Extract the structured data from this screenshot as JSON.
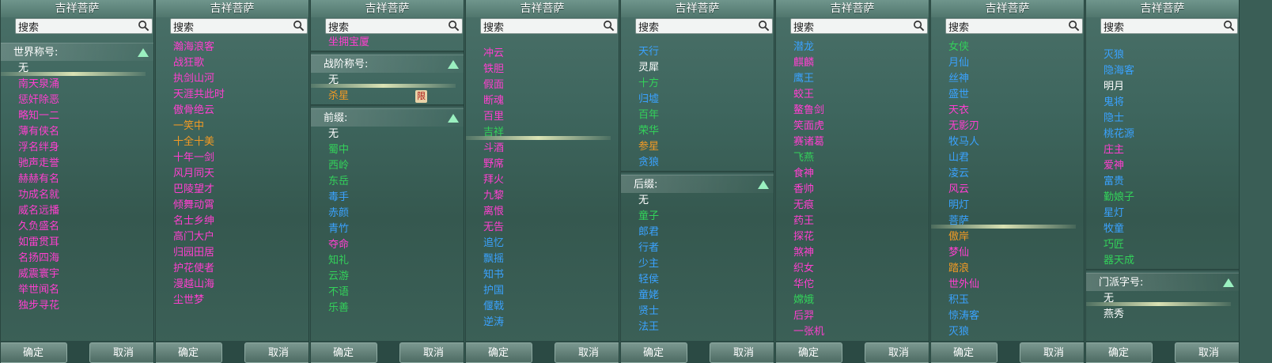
{
  "common": {
    "title": "吉祥菩萨",
    "search_placeholder": "搜索",
    "ok": "确定",
    "cancel": "取消"
  },
  "panels": [
    {
      "header1": "世界称号:",
      "items": [
        {
          "t": "无",
          "c": "white",
          "sel": true
        },
        {
          "t": "南天泉涌",
          "c": "mag"
        },
        {
          "t": "惩奸除恶",
          "c": "mag"
        },
        {
          "t": "略知一二",
          "c": "mag"
        },
        {
          "t": "薄有侠名",
          "c": "mag"
        },
        {
          "t": "浮名绊身",
          "c": "mag"
        },
        {
          "t": "驰声走誉",
          "c": "mag"
        },
        {
          "t": "赫赫有名",
          "c": "mag"
        },
        {
          "t": "功成名就",
          "c": "mag"
        },
        {
          "t": "威名远播",
          "c": "mag"
        },
        {
          "t": "久负盛名",
          "c": "mag"
        },
        {
          "t": "如雷贯耳",
          "c": "mag"
        },
        {
          "t": "名扬四海",
          "c": "mag"
        },
        {
          "t": "威震寰宇",
          "c": "mag"
        },
        {
          "t": "举世闻名",
          "c": "mag"
        },
        {
          "t": "独步寻花",
          "c": "mag"
        }
      ]
    },
    {
      "items": [
        {
          "t": "瀚海浪客",
          "c": "mag"
        },
        {
          "t": "战狂歌",
          "c": "mag"
        },
        {
          "t": "执剑山河",
          "c": "mag"
        },
        {
          "t": "天涯共此时",
          "c": "mag"
        },
        {
          "t": "傲骨绝云",
          "c": "mag"
        },
        {
          "t": "一笑中",
          "c": "orange"
        },
        {
          "t": "十全十美",
          "c": "orange"
        },
        {
          "t": "十年一剑",
          "c": "mag"
        },
        {
          "t": "风月同天",
          "c": "mag"
        },
        {
          "t": "巴陵望才",
          "c": "mag"
        },
        {
          "t": "倾舞动霄",
          "c": "mag"
        },
        {
          "t": "名士乡绅",
          "c": "mag"
        },
        {
          "t": "高门大户",
          "c": "mag"
        },
        {
          "t": "归园田居",
          "c": "mag"
        },
        {
          "t": "护花使者",
          "c": "mag"
        },
        {
          "t": "漫越山海",
          "c": "mag"
        },
        {
          "t": "尘世梦",
          "c": "mag"
        }
      ]
    },
    {
      "top_item": {
        "t": "坐拥宝厦",
        "c": "mag"
      },
      "header1": "战阶称号:",
      "mid_items": [
        {
          "t": "无",
          "c": "white",
          "sel": true
        },
        {
          "t": "杀星",
          "c": "orange",
          "badge": "限"
        }
      ],
      "header2": "前缀:",
      "items": [
        {
          "t": "无",
          "c": "white"
        },
        {
          "t": "蜀中",
          "c": "green"
        },
        {
          "t": "西岭",
          "c": "green"
        },
        {
          "t": "东岳",
          "c": "green"
        },
        {
          "t": "毒手",
          "c": "blue"
        },
        {
          "t": "赤颜",
          "c": "blue"
        },
        {
          "t": "青竹",
          "c": "blue"
        },
        {
          "t": "夺命",
          "c": "mag"
        },
        {
          "t": "知礼",
          "c": "green"
        },
        {
          "t": "云游",
          "c": "green"
        },
        {
          "t": "不语",
          "c": "green"
        },
        {
          "t": "乐善",
          "c": "green"
        }
      ]
    },
    {
      "items": [
        {
          "t": "冲云",
          "c": "mag"
        },
        {
          "t": "铁胆",
          "c": "mag"
        },
        {
          "t": "假面",
          "c": "mag"
        },
        {
          "t": "断魂",
          "c": "mag"
        },
        {
          "t": "百里",
          "c": "mag"
        },
        {
          "t": "吉祥",
          "c": "green",
          "sel": true
        },
        {
          "t": "斗酒",
          "c": "mag"
        },
        {
          "t": "野席",
          "c": "mag"
        },
        {
          "t": "拜火",
          "c": "mag"
        },
        {
          "t": "九黎",
          "c": "mag"
        },
        {
          "t": "离恨",
          "c": "mag"
        },
        {
          "t": "无告",
          "c": "mag"
        },
        {
          "t": "追忆",
          "c": "blue"
        },
        {
          "t": "飘摇",
          "c": "blue"
        },
        {
          "t": "知书",
          "c": "blue"
        },
        {
          "t": "护国",
          "c": "blue"
        },
        {
          "t": "偃戟",
          "c": "blue"
        },
        {
          "t": "逆涛",
          "c": "blue"
        }
      ]
    },
    {
      "items": [
        {
          "t": "天行",
          "c": "blue"
        },
        {
          "t": "灵犀",
          "c": "white"
        },
        {
          "t": "十方",
          "c": "green"
        },
        {
          "t": "归墟",
          "c": "blue"
        },
        {
          "t": "百年",
          "c": "green"
        },
        {
          "t": "荣华",
          "c": "green"
        },
        {
          "t": "参星",
          "c": "orange"
        },
        {
          "t": "贪狼",
          "c": "blue"
        }
      ],
      "header2": "后缀:",
      "items2": [
        {
          "t": "无",
          "c": "white"
        },
        {
          "t": "童子",
          "c": "green"
        },
        {
          "t": "郎君",
          "c": "blue"
        },
        {
          "t": "行者",
          "c": "blue"
        },
        {
          "t": "少主",
          "c": "blue"
        },
        {
          "t": "轻侯",
          "c": "blue"
        },
        {
          "t": "童姥",
          "c": "blue"
        },
        {
          "t": "贤士",
          "c": "blue"
        },
        {
          "t": "法王",
          "c": "blue"
        }
      ]
    },
    {
      "items": [
        {
          "t": "潜龙",
          "c": "blue"
        },
        {
          "t": "麒麟",
          "c": "mag"
        },
        {
          "t": "鹰王",
          "c": "blue"
        },
        {
          "t": "蛟王",
          "c": "mag"
        },
        {
          "t": "鳌鲁剑",
          "c": "mag"
        },
        {
          "t": "笑面虎",
          "c": "mag"
        },
        {
          "t": "赛诸葛",
          "c": "mag"
        },
        {
          "t": "飞燕",
          "c": "green"
        },
        {
          "t": "食神",
          "c": "mag"
        },
        {
          "t": "香帅",
          "c": "mag"
        },
        {
          "t": "无痕",
          "c": "mag"
        },
        {
          "t": "药王",
          "c": "mag"
        },
        {
          "t": "探花",
          "c": "mag"
        },
        {
          "t": "煞神",
          "c": "mag"
        },
        {
          "t": "织女",
          "c": "mag"
        },
        {
          "t": "华佗",
          "c": "mag"
        },
        {
          "t": "嫦娥",
          "c": "green"
        },
        {
          "t": "后羿",
          "c": "mag"
        },
        {
          "t": "一张机",
          "c": "mag"
        }
      ]
    },
    {
      "items": [
        {
          "t": "女侠",
          "c": "green"
        },
        {
          "t": "月仙",
          "c": "blue"
        },
        {
          "t": "丝神",
          "c": "blue"
        },
        {
          "t": "盛世",
          "c": "blue"
        },
        {
          "t": "天衣",
          "c": "mag"
        },
        {
          "t": "无影刃",
          "c": "mag"
        },
        {
          "t": "牧马人",
          "c": "blue"
        },
        {
          "t": "山君",
          "c": "blue"
        },
        {
          "t": "凌云",
          "c": "blue"
        },
        {
          "t": "风云",
          "c": "mag"
        },
        {
          "t": "明灯",
          "c": "blue"
        },
        {
          "t": "菩萨",
          "c": "blue",
          "sel": true
        },
        {
          "t": "傲岸",
          "c": "orange"
        },
        {
          "t": "梦仙",
          "c": "mag"
        },
        {
          "t": "踏浪",
          "c": "orange"
        },
        {
          "t": "世外仙",
          "c": "mag"
        },
        {
          "t": "积玉",
          "c": "blue"
        },
        {
          "t": "惊涛客",
          "c": "blue"
        },
        {
          "t": "灭狼",
          "c": "blue"
        }
      ]
    },
    {
      "items": [
        {
          "t": "灭狼",
          "c": "blue"
        },
        {
          "t": "隐海客",
          "c": "blue"
        },
        {
          "t": "明月",
          "c": "white"
        },
        {
          "t": "鬼将",
          "c": "blue"
        },
        {
          "t": "隐士",
          "c": "blue"
        },
        {
          "t": "桃花源",
          "c": "blue"
        },
        {
          "t": "庄主",
          "c": "mag"
        },
        {
          "t": "爱神",
          "c": "mag"
        },
        {
          "t": "富贵",
          "c": "blue"
        },
        {
          "t": "勤娘子",
          "c": "green"
        },
        {
          "t": "星灯",
          "c": "blue"
        },
        {
          "t": "牧童",
          "c": "blue"
        },
        {
          "t": "巧匠",
          "c": "green"
        },
        {
          "t": "器天成",
          "c": "green"
        }
      ],
      "header2": "门派字号:",
      "items2": [
        {
          "t": "无",
          "c": "white",
          "sel": true
        },
        {
          "t": "燕秀",
          "c": "white"
        }
      ]
    }
  ]
}
